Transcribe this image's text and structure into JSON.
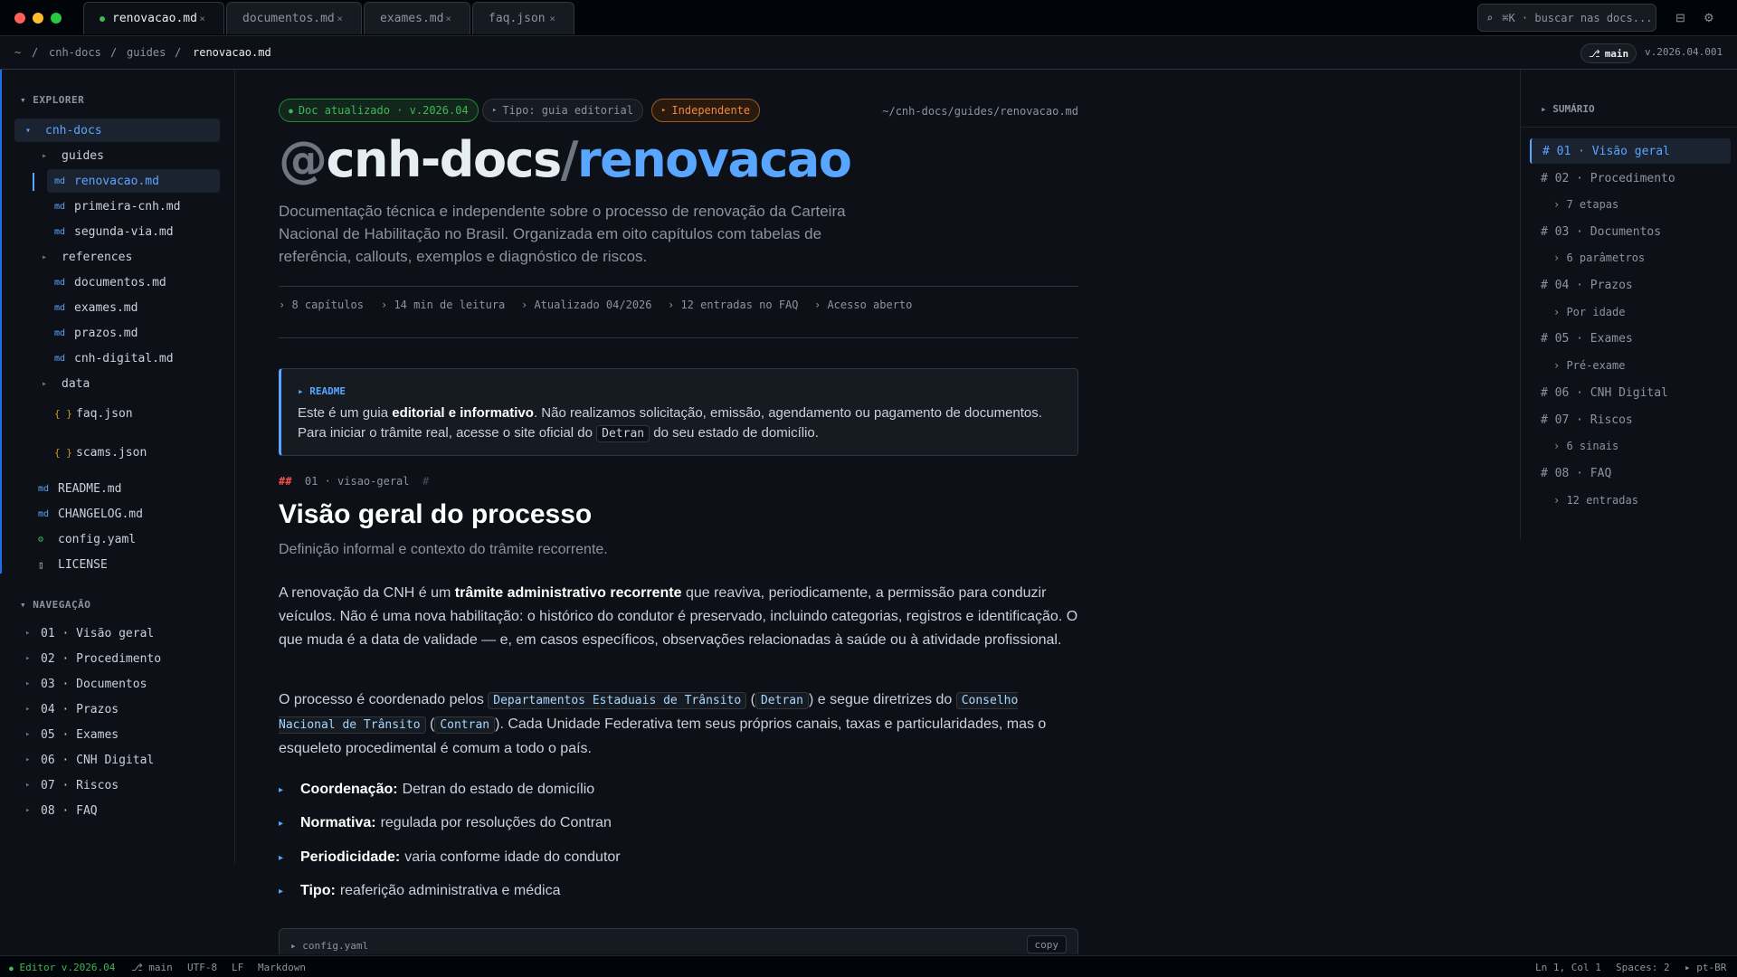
{
  "tabs": [
    {
      "label": "renovacao.md",
      "close": "×"
    },
    {
      "label": "documentos.md",
      "close": "×"
    },
    {
      "label": "exames.md",
      "close": "×"
    },
    {
      "label": "faq.json",
      "close": "×"
    }
  ],
  "search": {
    "icon": "⌕",
    "label": "⌘K · buscar nas docs..."
  },
  "titlebar_icons": {
    "layout": "⊟",
    "settings": "⚙"
  },
  "breadcrumb": {
    "home": "~",
    "sep": "/",
    "items": [
      "cnh-docs",
      "guides",
      "renovacao.md"
    ]
  },
  "branch": {
    "icon": "⎇",
    "label": "main"
  },
  "version": "v.2026.04.001",
  "sidebar": {
    "explorer_title": "EXPLORER",
    "tree": [
      {
        "icon": "▾",
        "label": "cnh-docs"
      },
      {
        "icon": "▸",
        "label": "guides"
      },
      {
        "icon": "md",
        "label": "renovacao.md"
      },
      {
        "icon": "md",
        "label": "primeira-cnh.md"
      },
      {
        "icon": "md",
        "label": "segunda-via.md"
      },
      {
        "icon": "▸",
        "label": "references"
      },
      {
        "icon": "md",
        "label": "documentos.md"
      },
      {
        "icon": "md",
        "label": "exames.md"
      },
      {
        "icon": "md",
        "label": "prazos.md"
      },
      {
        "icon": "md",
        "label": "cnh-digital.md"
      },
      {
        "icon": "▸",
        "label": "data"
      },
      {
        "icon": "{ }",
        "label": "faq.json"
      },
      {
        "icon": "{ }",
        "label": "scams.json"
      },
      {
        "icon": "md",
        "label": "README.md"
      },
      {
        "icon": "md",
        "label": "CHANGELOG.md"
      },
      {
        "icon": "⚙",
        "label": "config.yaml"
      },
      {
        "icon": "▯",
        "label": "LICENSE"
      }
    ],
    "nav_title": "NAVEGAÇÃO",
    "nav": [
      "01 · Visão geral",
      "02 · Procedimento",
      "03 · Documentos",
      "04 · Prazos",
      "05 · Exames",
      "06 · CNH Digital",
      "07 · Riscos",
      "08 · FAQ"
    ]
  },
  "main": {
    "pills": [
      {
        "dot": "●",
        "label": "Doc atualizado · v.2026.04"
      },
      {
        "dot": "▸",
        "label": "Tipo: guia editorial"
      },
      {
        "dot": "▸",
        "label": "Independente"
      }
    ],
    "path": "~/cnh-docs/guides/renovacao.md",
    "title": {
      "at": "@",
      "scope": "cnh-docs",
      "slash": "/",
      "name": "renovacao"
    },
    "lede": "Documentação técnica e independente sobre o processo de renovação da Carteira Nacional de Habilitação no Brasil. Organizada em oito capítulos com tabelas de referência, callouts, exemplos e diagnóstico de riscos.",
    "meta": [
      "› 8 capítulos",
      "› 14 min de leitura",
      "› Atualizado 04/2026",
      "› 12 entradas no FAQ",
      "› Acesso aberto"
    ],
    "callout": {
      "label": "▸ README",
      "t1": "Este é um guia ",
      "b1": "editorial e informativo",
      "t2": ". Não realizamos solicitação, emissão, agendamento ou pagamento de documentos. Para iniciar o trâmite real, acesse o site oficial do ",
      "code": "Detran",
      "t3": " do seu estado de domicílio."
    },
    "section": {
      "hash": "##",
      "anchor": "01 · visao-geral",
      "anchor_hash": "#",
      "title": "Visão geral do processo",
      "subtitle": "Definição informal e contexto do trâmite recorrente."
    },
    "p1": {
      "t1": "A renovação da CNH é um ",
      "b1": "trâmite administrativo recorrente",
      "t2": " que reaviva, periodicamente, a permissão para conduzir veículos. Não é uma nova habilitação: o histórico do condutor é preservado, incluindo categorias, registros e identificação. O que muda é a data de validade — e, em casos específicos, observações relacionadas à saúde ou à atividade profissional."
    },
    "p2": {
      "t1": "O processo é coordenado pelos ",
      "c1": "Departamentos Estaduais de Trânsito",
      "t2": " (",
      "c2": "Detran",
      "t3": ") e segue diretrizes do ",
      "c3": "Conselho Nacional de Trânsito",
      "t4": " (",
      "c4": "Contran",
      "t5": "). Cada Unidade Federativa tem seus próprios canais, taxas e particularidades, mas o esqueleto procedimental é comum a todo o país."
    },
    "bullets": [
      {
        "k": "Coordenação:",
        "v": "Detran do estado de domicílio"
      },
      {
        "k": "Normativa:",
        "v": "regulada por resoluções do Contran"
      },
      {
        "k": "Periodicidade:",
        "v": "varia conforme idade do condutor"
      },
      {
        "k": "Tipo:",
        "v": "reaferição administrativa e médica"
      }
    ],
    "codeblock": {
      "file": "▸ config.yaml",
      "copy": "copy"
    }
  },
  "toc": {
    "title": "▸ SUMÁRIO",
    "items": [
      {
        "label": "# 01 · Visão geral",
        "sub": false
      },
      {
        "label": "# 02 · Procedimento",
        "sub": false
      },
      {
        "label": "› 7 etapas",
        "sub": true
      },
      {
        "label": "# 03 · Documentos",
        "sub": false
      },
      {
        "label": "› 6 parâmetros",
        "sub": true
      },
      {
        "label": "# 04 · Prazos",
        "sub": false
      },
      {
        "label": "› Por idade",
        "sub": true
      },
      {
        "label": "# 05 · Exames",
        "sub": false
      },
      {
        "label": "› Pré-exame",
        "sub": true
      },
      {
        "label": "# 06 · CNH Digital",
        "sub": false
      },
      {
        "label": "# 07 · Riscos",
        "sub": false
      },
      {
        "label": "› 6 sinais",
        "sub": true
      },
      {
        "label": "# 08 · FAQ",
        "sub": false
      },
      {
        "label": "› 12 entradas",
        "sub": true
      }
    ]
  },
  "statusbar": {
    "editor": "Editor v.2026.04",
    "branch": "⎇ main",
    "encoding": "UTF-8",
    "eol": "LF",
    "language": "Markdown",
    "position": "Ln 1, Col 1",
    "spaces": "Spaces: 2",
    "locale": "▸ pt-BR"
  },
  "colors": {
    "accent": "#58a6ff",
    "success": "#3fb950",
    "warning": "#f0883e",
    "background": "#0d1117"
  }
}
